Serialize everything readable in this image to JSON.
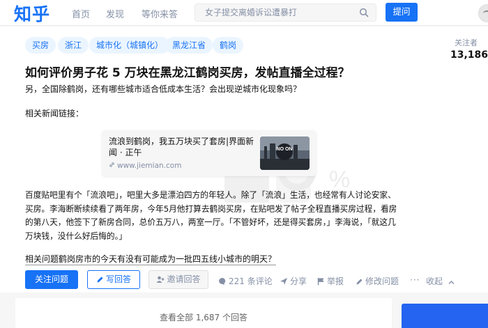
{
  "header": {
    "logo": "知乎",
    "nav": [
      "首页",
      "发现",
      "等你来答"
    ],
    "search_placeholder": "女子提交离婚诉讼遭暴打",
    "ask_label": "提问"
  },
  "question": {
    "topics": [
      "买房",
      "浙江",
      "城市化（城镇化）",
      "黑龙江省",
      "鹤岗"
    ],
    "title": "如何评价男子花 5 万块在黑龙江鹤岗买房，发帖直播全过程？",
    "subtitle": "另，全国除鹤岗，还有哪些城市适合低成本生活？会出现逆城市化现象吗？",
    "news_label": "相关新闻链接：",
    "link_card": {
      "title": "流浪到鹤岗，我五万块买了套房|界面新闻 · 正午",
      "url": "www.jiemian.com",
      "thumb_text": "NO ON"
    },
    "body": "百度贴吧里有个「流浪吧」，吧里大多是漂泊四方的年轻人。除了「流浪」生活，也经常有人讨论安家、买房。李海断断续续看了两年房，今年5月他打算去鹤岗买房，在贴吧发了帖子全程直播买房过程，看房的第八天，他签下了新房合同，总价五万八，两室一厅。「不管好坏，还是得买套房，」李海说，「就这几万块钱，没什么好后悔的。」",
    "related": "相关问题鹤岗房市的今天有没有可能成为一批四五线小城市的明天？",
    "followers_label": "关注者",
    "followers_count": "13,186"
  },
  "actions": {
    "follow": "关注问题",
    "write": "写回答",
    "invite": "邀请回答",
    "comments": "221 条评论",
    "share": "分享",
    "report": "举报",
    "edit": "修改问题",
    "collapse": "收起"
  },
  "footer": {
    "view_all": "查看全部 1,687 个回答"
  },
  "colors": {
    "brand": "#1772f6",
    "tag_bg": "#ebf5ff",
    "muted": "#8590a6"
  }
}
